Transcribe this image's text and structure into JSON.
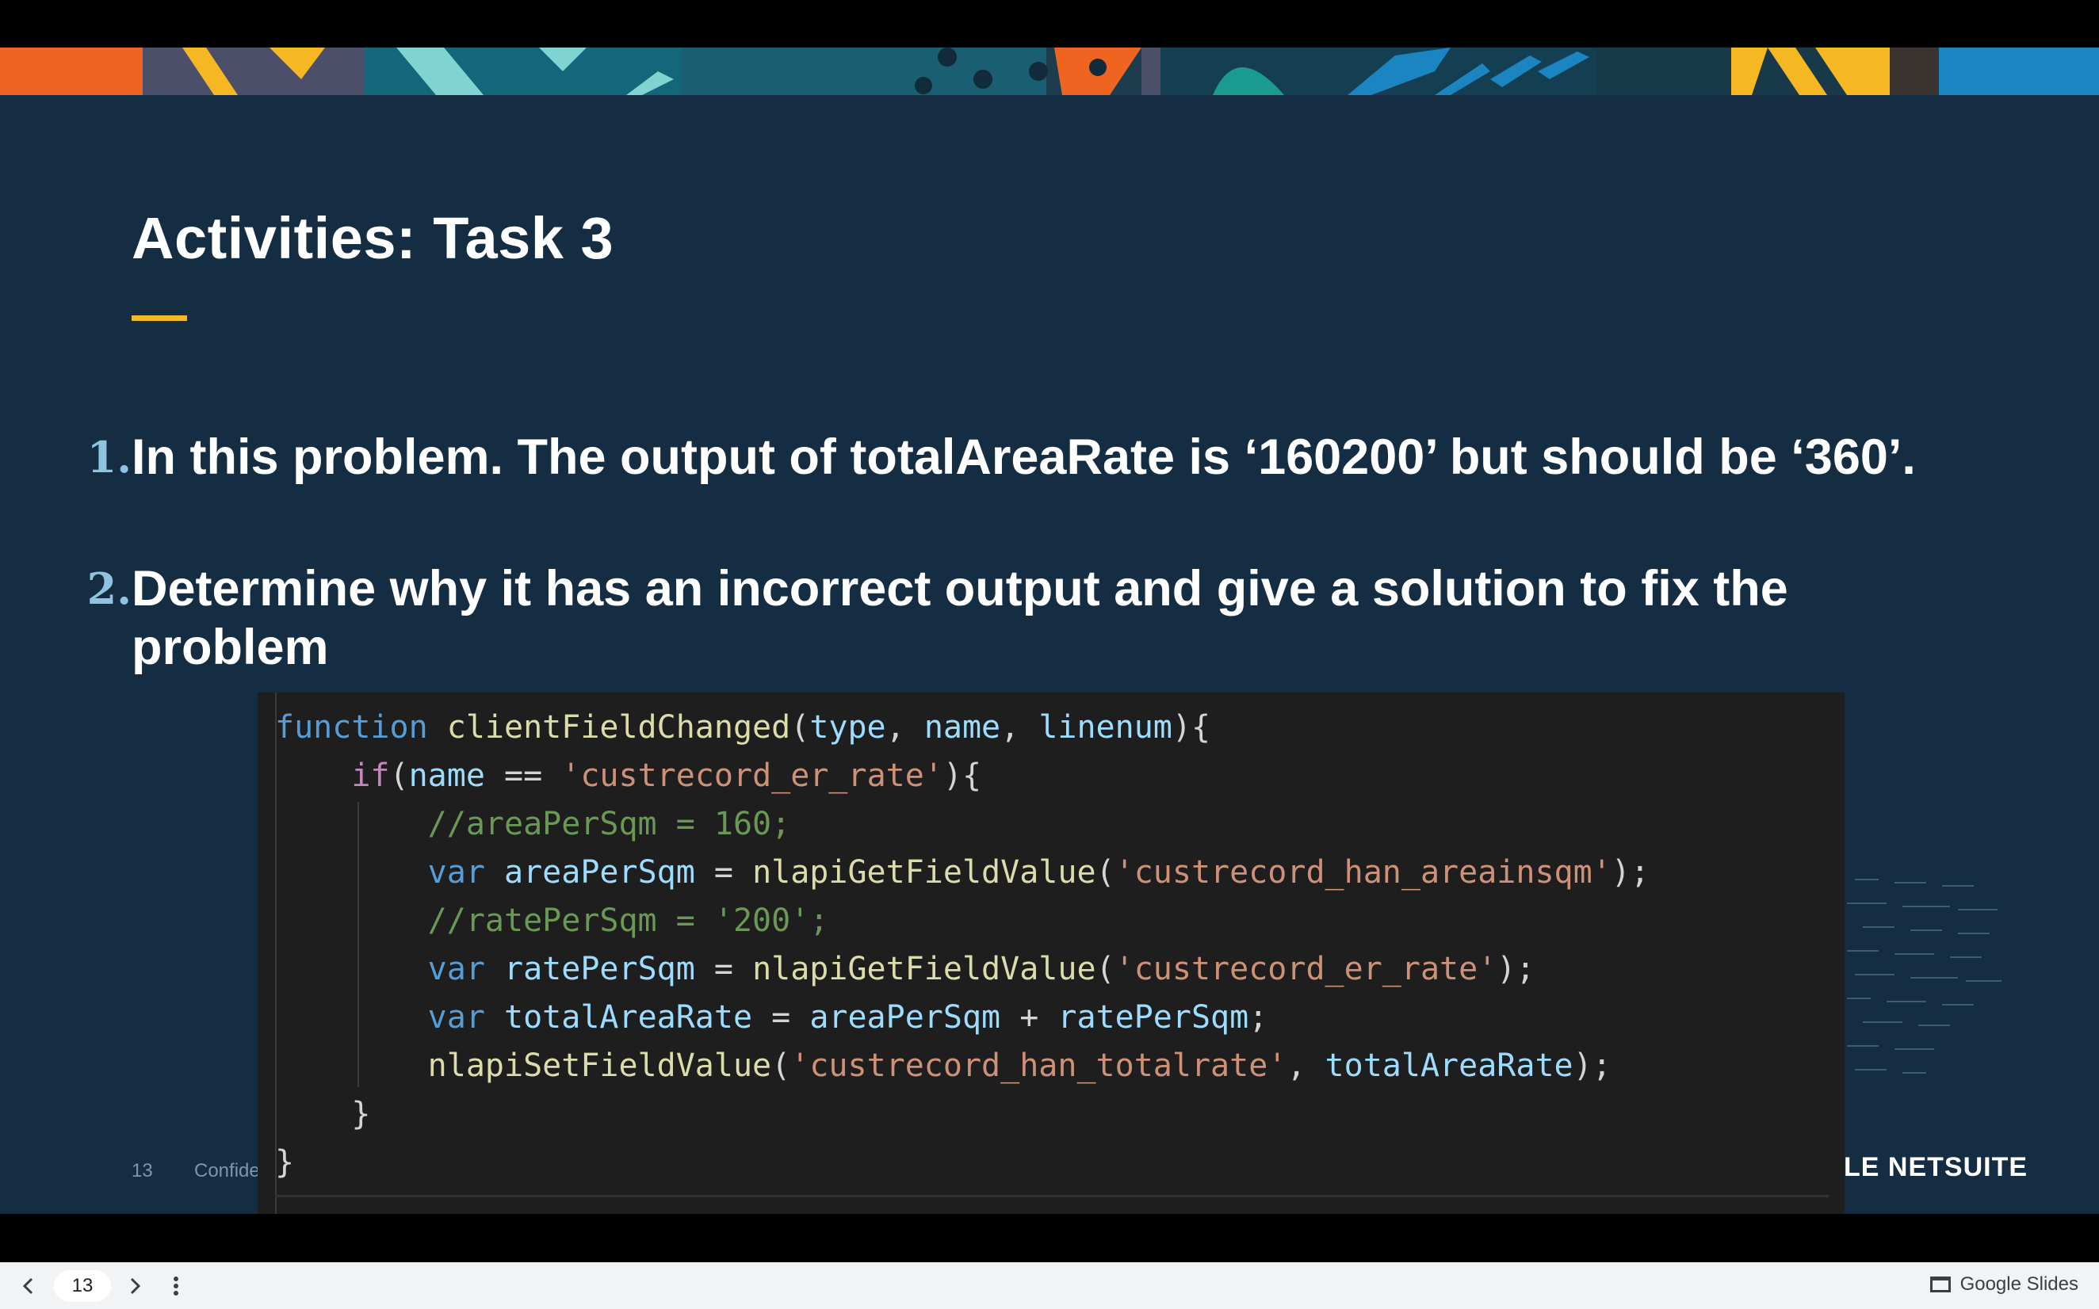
{
  "slide": {
    "title": "Activities: Task 3",
    "items": [
      {
        "number": "1.",
        "text": "In this problem. The output of totalAreaRate is ‘160200’ but should be ‘360’."
      },
      {
        "number": "2.",
        "text": "Determine why it has an incorrect output and give a solution to fix the problem"
      }
    ],
    "code": {
      "line1": {
        "kw": "function",
        "fn": " clientFieldChanged",
        "open": "(",
        "p1": "type",
        "c1": ", ",
        "p2": "name",
        "c2": ", ",
        "p3": "linenum",
        "close": "){"
      },
      "line2": {
        "indent": "    ",
        "kw": "if",
        "open": "(",
        "var": "name",
        "op": " == ",
        "str": "'custrecord_er_rate'",
        "close": "){"
      },
      "line3": {
        "indent": "        ",
        "cmt": "//areaPerSqm = 160;"
      },
      "line4": {
        "indent": "        ",
        "kw": "var",
        "var": " areaPerSqm",
        "op": " = ",
        "fn": "nlapiGetFieldValue",
        "open": "(",
        "str": "'custrecord_han_areainsqm'",
        "close": ");"
      },
      "line5": {
        "indent": "        ",
        "cmt": "//ratePerSqm = '200';"
      },
      "line6": {
        "indent": "        ",
        "kw": "var",
        "var": " ratePerSqm",
        "op": " = ",
        "fn": "nlapiGetFieldValue",
        "open": "(",
        "str": "'custrecord_er_rate'",
        "close": ");"
      },
      "line7": {
        "indent": "        ",
        "kw": "var",
        "var": " totalAreaRate",
        "op": " = ",
        "a": "areaPerSqm",
        "plus": " + ",
        "b": "ratePerSqm",
        "close": ";"
      },
      "line8": {
        "indent": "        ",
        "fn": "nlapiSetFieldValue",
        "open": "(",
        "str": "'custrecord_han_totalrate'",
        "comma": ", ",
        "var": "totalAreaRate",
        "close": ");"
      },
      "line9": {
        "text": "    }"
      },
      "line10": {
        "text": "}"
      }
    },
    "footer": {
      "page_number": "13",
      "confidential": "Confidential"
    },
    "logo": "LE NETSUITE",
    "colors": {
      "background": "#152d42",
      "accent": "#f2b825",
      "list_number": "#8fc3df"
    }
  },
  "toolbar": {
    "prev_icon": "chevron-left-icon",
    "next_icon": "chevron-right-icon",
    "more_icon": "more-vert-icon",
    "slide_number": "13",
    "brand": "Google Slides"
  }
}
